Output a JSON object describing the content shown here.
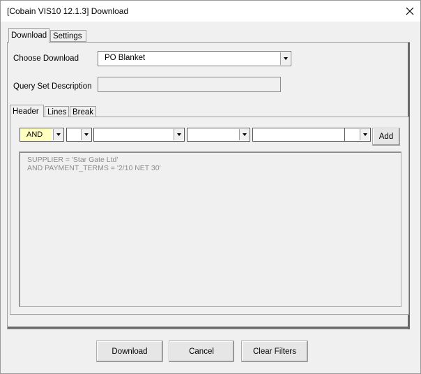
{
  "window": {
    "title": "[Cobain VIS10 12.1.3] Download",
    "close_glyph": "✕"
  },
  "outer_tabs": [
    {
      "label": "Download",
      "active": true
    },
    {
      "label": "Settings",
      "active": false
    }
  ],
  "form": {
    "choose_download_label": "Choose Download",
    "choose_download_value": "PO Blanket",
    "query_set_description_label": "Query Set Description",
    "query_set_description_value": ""
  },
  "inner_tabs": [
    {
      "label": "Header",
      "active": true
    },
    {
      "label": "Lines",
      "active": false
    },
    {
      "label": "Break",
      "active": false
    }
  ],
  "filter": {
    "conjunction_value": "AND",
    "add_label": "Add"
  },
  "query_lines": [
    "SUPPLIER = 'Star Gate Ltd'",
    "AND PAYMENT_TERMS = '2/10 NET 30'"
  ],
  "buttons": {
    "download": "Download",
    "cancel": "Cancel",
    "clear_filters": "Clear Filters"
  }
}
